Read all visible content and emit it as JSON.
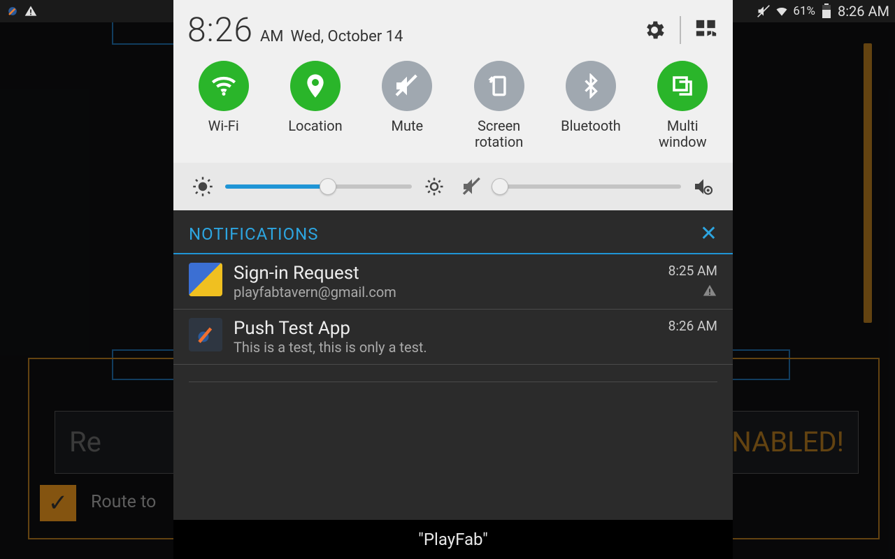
{
  "statusbar": {
    "battery_pct": "61%",
    "time": "8:26 AM"
  },
  "shade": {
    "clock": {
      "time": "8:26",
      "ampm": "AM",
      "date": "Wed, October 14"
    },
    "toggles": [
      {
        "label": "Wi-Fi",
        "on": true
      },
      {
        "label": "Location",
        "on": true
      },
      {
        "label": "Mute",
        "on": false
      },
      {
        "label": "Screen\nrotation",
        "on": false
      },
      {
        "label": "Bluetooth",
        "on": false
      },
      {
        "label": "Multi\nwindow",
        "on": true
      }
    ],
    "brightness_pct": 55,
    "volume_pct": 3
  },
  "notifications": {
    "title": "NOTIFICATIONS",
    "items": [
      {
        "title": "Sign-in Request",
        "sub": "playfabtavern@gmail.com",
        "time": "8:25 AM",
        "warn": true
      },
      {
        "title": "Push Test App",
        "sub": "This is a test, this is only a test.",
        "time": "8:26 AM",
        "warn": false
      }
    ]
  },
  "bg": {
    "reg_left": "Re",
    "reg_right": "ENABLED!",
    "route": "Route to",
    "checked": true
  },
  "playfab": "\"PlayFab\""
}
